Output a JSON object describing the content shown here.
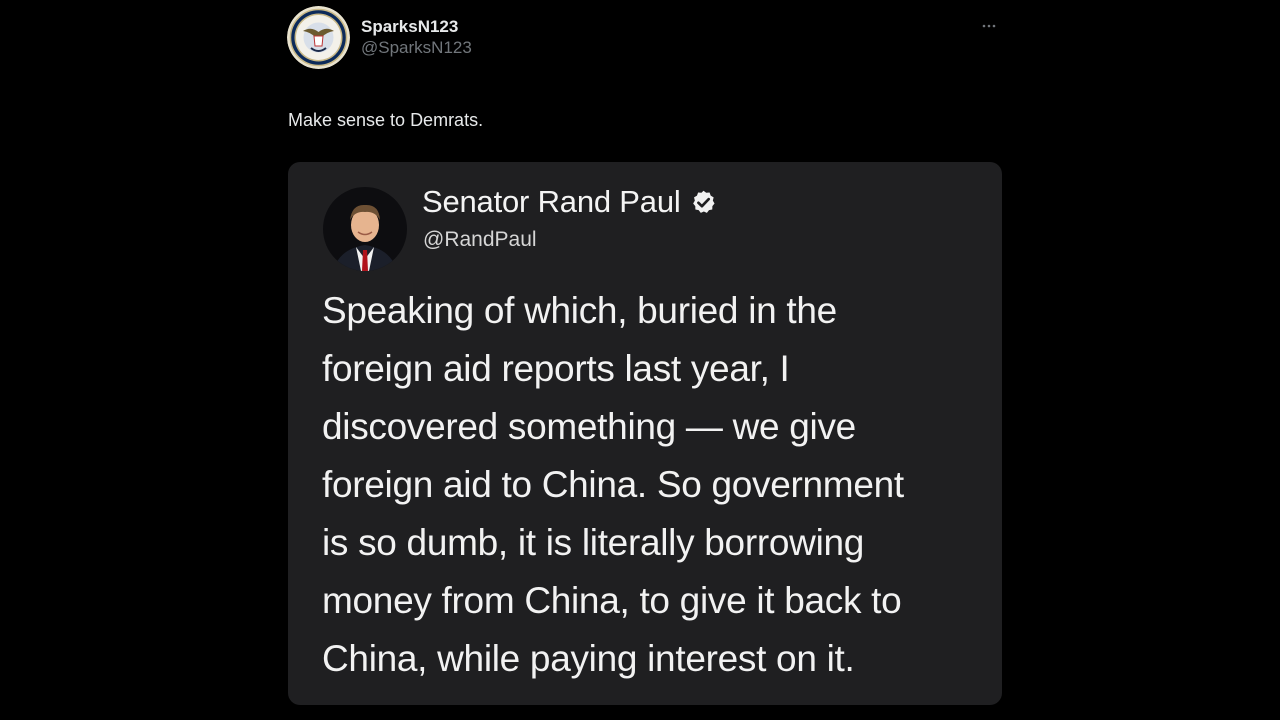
{
  "post": {
    "display_name": "SparksN123",
    "handle": "@SparksN123",
    "more_icon": "more-horizontal-icon",
    "text": "Make sense to Demrats."
  },
  "quoted": {
    "display_name": "Senator Rand Paul",
    "handle": "@RandPaul",
    "verified_icon": "verified-badge-icon",
    "lines": [
      "Speaking of which, buried in the",
      "foreign aid reports last year, I",
      "discovered something — we give",
      "foreign aid to China. So government",
      "is so dumb, it is literally borrowing",
      "money from China, to give it back to",
      "China, while paying interest on it."
    ]
  },
  "colors": {
    "background": "#000000",
    "card": "#1f1f21",
    "primary_text": "#e7e9ea",
    "secondary_text": "#71767b"
  }
}
